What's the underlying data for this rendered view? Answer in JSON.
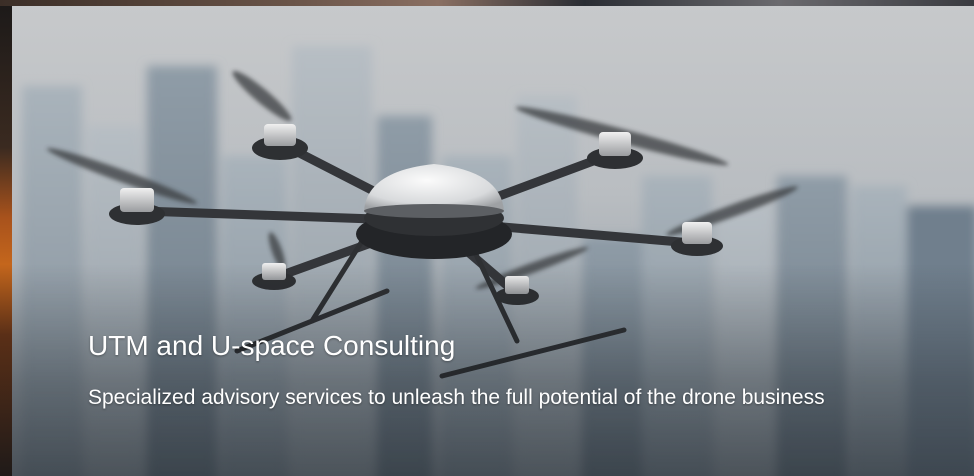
{
  "slide": {
    "title": "UTM and U-space Consulting",
    "subtitle": "Specialized advisory services to unleash the full potential of the drone business"
  },
  "colors": {
    "text": "#ffffff",
    "sky": "#c7c9cb",
    "buildings": "#9aa4ad",
    "drone_body": "#2b2d30",
    "drone_dome": "#e6e7e8"
  },
  "icons": {
    "hero_image": "hexacopter-drone-over-city-photo"
  }
}
